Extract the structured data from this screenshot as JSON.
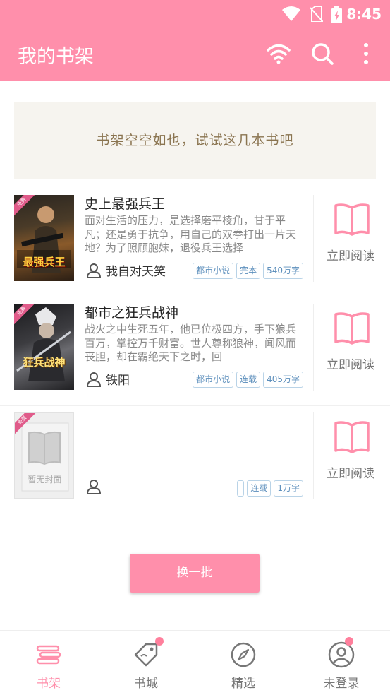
{
  "status": {
    "time": "8:45"
  },
  "appbar": {
    "title": "我的书架"
  },
  "banner": {
    "text": "书架空空如也，试试这几本书吧"
  },
  "books": [
    {
      "title": "史上最强兵王",
      "desc": "面对生活的压力，是选择磨平棱角，甘于平凡；还是勇于抗争，用自己的双拳打出一片天地？为了照顾胞妹，退役兵王选择",
      "author": "我自对天笑",
      "tags": [
        "都市小说",
        "完本",
        "540万字"
      ],
      "read_label": "立即阅读",
      "badge": "免费",
      "cover_text": "最强兵王"
    },
    {
      "title": "都市之狂兵战神",
      "desc": "战火之中生死五年，他已位极四方，手下狼兵百万，掌控万千财富。世人尊称狼神，闻风而丧胆，却在霸绝天下之时，回",
      "author": "铁阳",
      "tags": [
        "都市小说",
        "连载",
        "405万字"
      ],
      "read_label": "立即阅读",
      "badge": "免费",
      "cover_text": "狂兵战神"
    },
    {
      "title": "",
      "desc": "",
      "author": "",
      "tags": [
        "",
        "连载",
        "1万字"
      ],
      "read_label": "立即阅读",
      "badge": "免费",
      "cover_text": "暂无封面"
    }
  ],
  "refresh_label": "换一批",
  "nav": [
    {
      "label": "书架",
      "icon": "bookshelf-icon"
    },
    {
      "label": "书城",
      "icon": "store-tag-icon"
    },
    {
      "label": "精选",
      "icon": "compass-icon"
    },
    {
      "label": "未登录",
      "icon": "user-icon"
    }
  ],
  "colors": {
    "accent": "#ff8fab",
    "banner_text": "#8a7450",
    "tag_text": "#5d8fbc"
  }
}
